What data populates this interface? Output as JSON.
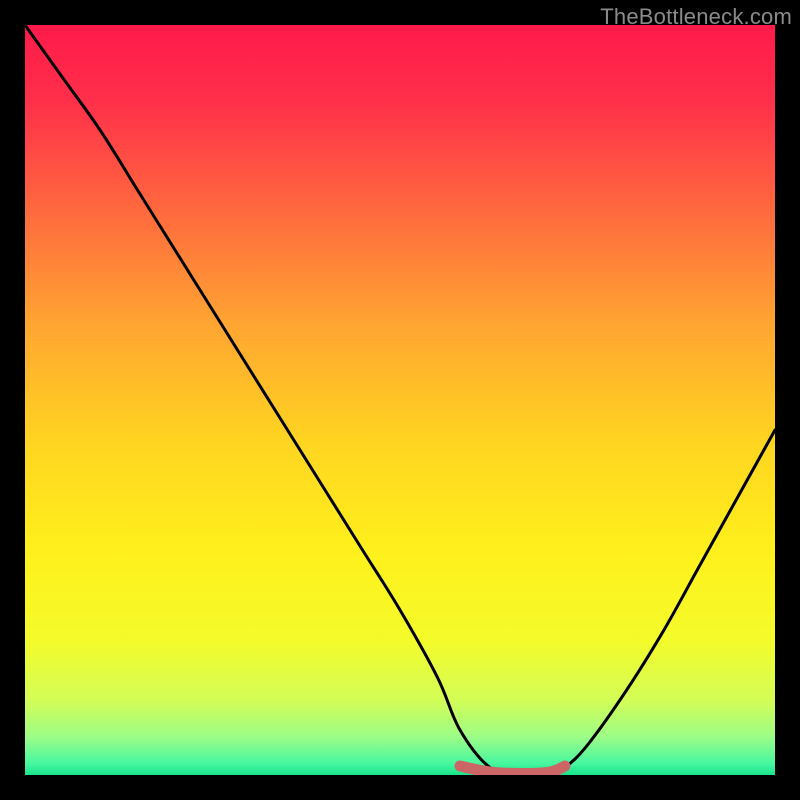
{
  "watermark": "TheBottleneck.com",
  "chart_data": {
    "type": "line",
    "title": "",
    "xlabel": "",
    "ylabel": "",
    "xlim": [
      0,
      100
    ],
    "ylim": [
      0,
      100
    ],
    "grid": false,
    "legend": false,
    "series": [
      {
        "name": "bottleneck-curve",
        "color": "#000000",
        "x": [
          0,
          5,
          10,
          15,
          20,
          25,
          30,
          35,
          40,
          45,
          50,
          55,
          58,
          62,
          66,
          70,
          72,
          75,
          80,
          85,
          90,
          95,
          100
        ],
        "y": [
          100,
          93,
          86,
          78,
          70,
          62,
          54,
          46,
          38,
          30,
          22,
          13,
          6,
          1,
          0,
          0,
          1,
          4,
          11,
          19,
          28,
          37,
          46
        ]
      },
      {
        "name": "optimal-range-marker",
        "color": "#cc6666",
        "x": [
          58,
          62,
          66,
          70,
          72
        ],
        "y": [
          1.2,
          0.4,
          0.2,
          0.4,
          1.2
        ]
      }
    ],
    "background_gradient_stops": [
      {
        "offset": 0.0,
        "color": "#ff1a4b"
      },
      {
        "offset": 0.1,
        "color": "#ff2f4a"
      },
      {
        "offset": 0.25,
        "color": "#ff6a3e"
      },
      {
        "offset": 0.4,
        "color": "#ffa531"
      },
      {
        "offset": 0.55,
        "color": "#ffd321"
      },
      {
        "offset": 0.7,
        "color": "#fff01c"
      },
      {
        "offset": 0.82,
        "color": "#f4fb2a"
      },
      {
        "offset": 0.9,
        "color": "#d3fd56"
      },
      {
        "offset": 0.95,
        "color": "#9bfd87"
      },
      {
        "offset": 0.985,
        "color": "#46f7a0"
      },
      {
        "offset": 1.0,
        "color": "#17e38a"
      }
    ]
  }
}
